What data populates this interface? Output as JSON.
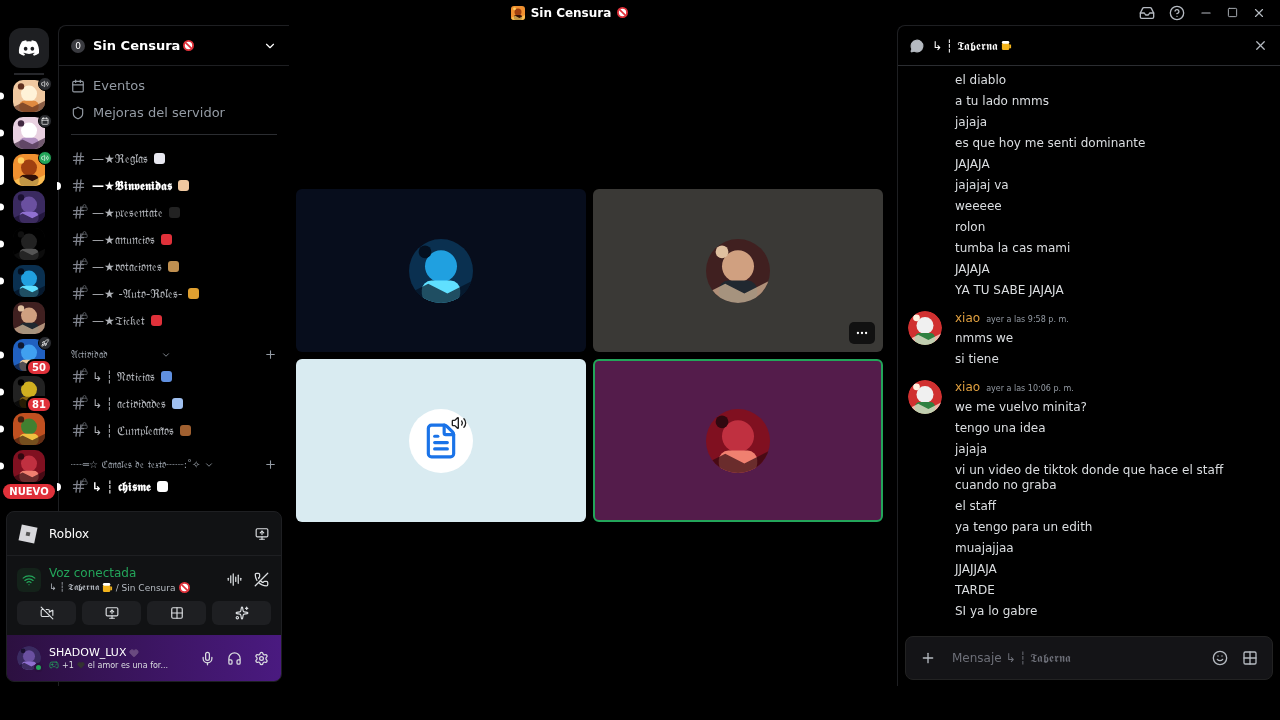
{
  "title_bar": {
    "title": "Sin Censura"
  },
  "servers": [
    {
      "kind": "voice",
      "selected": false,
      "unread": true
    },
    {
      "kind": "event",
      "selected": false,
      "unread": true
    },
    {
      "kind": "live",
      "selected": true,
      "unread": false
    },
    {
      "kind": "plain",
      "selected": false,
      "unread": true
    },
    {
      "kind": "plain",
      "selected": false,
      "unread": true
    },
    {
      "kind": "plain",
      "selected": false,
      "unread": true
    },
    {
      "kind": "plain",
      "selected": false,
      "unread": false
    },
    {
      "kind": "boost",
      "selected": false,
      "unread": true,
      "badge": "50"
    },
    {
      "kind": "plain",
      "selected": false,
      "unread": true,
      "badge": "81"
    },
    {
      "kind": "plain",
      "selected": false,
      "unread": true
    },
    {
      "kind": "plain",
      "selected": false,
      "unread": true
    }
  ],
  "new_pill": "NUEVO",
  "server_header": {
    "boost_count": "0",
    "name": "Sin Censura"
  },
  "server_menu": [
    {
      "kind": "events",
      "label": "Eventos"
    },
    {
      "kind": "boosts",
      "label": "Mejoras del servidor"
    }
  ],
  "channels": [
    {
      "kind": "channel",
      "name": "—★ℜ𝔢𝔤𝔩𝔞𝔰",
      "unread": false,
      "locked": false
    },
    {
      "kind": "channel",
      "name": "—★𝕭𝖎𝖓𝖛𝖊𝖓𝖎𝖉𝖆𝖘",
      "unread": true,
      "locked": false
    },
    {
      "kind": "channel",
      "name": "—★𝔭𝔯𝔢𝔰𝔢𝔫𝔱𝔞𝔱𝔢",
      "unread": false,
      "locked": true
    },
    {
      "kind": "channel",
      "name": "—★𝔞𝔫𝔲𝔫𝔠𝔦𝔬𝔰",
      "unread": false,
      "locked": true
    },
    {
      "kind": "channel",
      "name": "—★𝔳𝔬𝔱𝔞𝔠𝔦𝔬𝔫𝔢𝔰",
      "unread": false,
      "locked": true
    },
    {
      "kind": "channel",
      "name": "—★ -𝔄𝔲𝔱𝔬-ℜ𝔬𝔩𝔢𝔰-",
      "unread": false,
      "locked": true
    },
    {
      "kind": "channel",
      "name": "—★𝔗𝔦𝔠𝔨𝔢𝔱",
      "unread": false,
      "locked": true
    },
    {
      "kind": "category",
      "name": "𝔄𝔠𝔱𝔦𝔳𝔦𝔡𝔞𝔡"
    },
    {
      "kind": "channel",
      "name": "↳ ┆ 𝔑𝔬𝔱𝔦𝔠𝔦𝔞𝔰",
      "unread": false,
      "locked": true
    },
    {
      "kind": "channel",
      "name": "↳ ┆ 𝔞𝔠𝔱𝔦𝔳𝔦𝔡𝔞𝔡𝔢𝔰",
      "unread": false,
      "locked": true
    },
    {
      "kind": "channel",
      "name": "↳ ┆ ℭ𝔲𝔪𝔭𝔩𝔢𝔞𝔫̃𝔬𝔰",
      "unread": false,
      "locked": true
    },
    {
      "kind": "category",
      "name": "┈┈═☆ ℭ𝔞𝔫𝔞𝔩𝔢𝔰 𝔡𝔢 𝔱𝔢𝔵𝔱𝔬┈┈┈:˚✧"
    },
    {
      "kind": "channel",
      "name": "↳ ┆ 𝖈𝖍𝖎𝖘𝖒𝖊",
      "unread": true,
      "locked": true
    }
  ],
  "activity_card": {
    "game": "Roblox"
  },
  "voice": {
    "status": "Voz conectada",
    "channel": "↳ ┆ 𝕿𝖆𝖇𝖊𝖗𝖓𝖆",
    "server": "/ Sin Censura"
  },
  "user": {
    "name": "SHADOW_LUX",
    "extra": "+1",
    "status_text": "el amor es una for...",
    "online": true
  },
  "video_tiles": [
    {
      "kind": "avatar",
      "speaking": false,
      "menu": false
    },
    {
      "kind": "avatar",
      "speaking": false,
      "menu": true
    },
    {
      "kind": "app",
      "speaking": false,
      "menu": false
    },
    {
      "kind": "avatar",
      "speaking": true,
      "menu": false
    }
  ],
  "chat": {
    "title": "↳ ┆ 𝕿𝖆𝖇𝖊𝖗𝖓𝖆",
    "placeholder": "Mensaje ↳ ┆ 𝕿𝖆𝖇𝖊𝖗𝖓𝖆",
    "groups": [
      {
        "lines": [
          "el diablo",
          "a tu lado nmms",
          "jajaja",
          "es que hoy me senti dominante",
          "JAJAJA",
          "jajajaj va",
          "weeeee",
          "rolon",
          "tumba la cas mami",
          "JAJAJA",
          "YA TU SABE JAJAJA"
        ]
      },
      {
        "author": "xiao",
        "time": "ayer a las 9:58 p. m.",
        "lines": [
          "nmms we",
          "si tiene"
        ]
      },
      {
        "author": "xiao",
        "time": "ayer a las 10:06 p. m.",
        "lines": [
          "we me vuelvo minita?",
          "tengo una idea",
          "jajaja",
          "vi un video de tiktok donde que hace el staff cuando no graba",
          "el staff",
          "ya tengo para un edith",
          "muajajjaa",
          "JJAJJAJA",
          "TARDE",
          "SI ya lo gabre"
        ]
      }
    ]
  }
}
